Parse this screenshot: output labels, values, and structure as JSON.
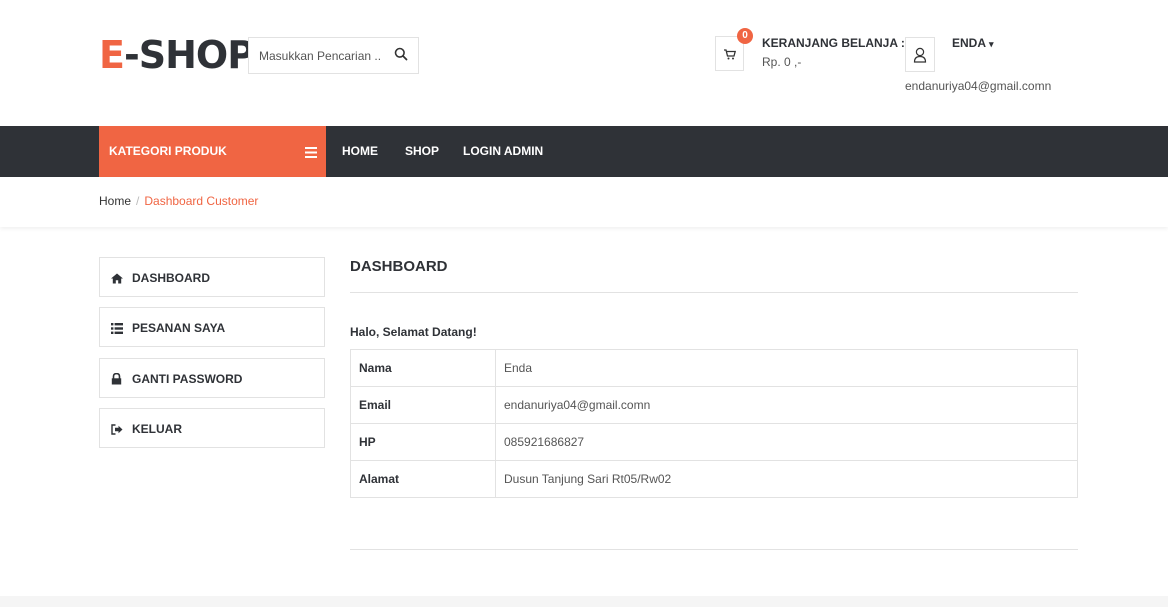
{
  "brand": {
    "logo_first": "E",
    "logo_rest": "-SHOP"
  },
  "search": {
    "placeholder": "Masukkan Pencarian ..",
    "icon": "search-icon"
  },
  "cart": {
    "count": "0",
    "title": "KERANJANG BELANJA :",
    "total": "Rp. 0 ,-",
    "icon": "cart-icon"
  },
  "user": {
    "name": "ENDA",
    "caret": "▾",
    "email": "endanuriya04@gmail.comn",
    "icon": "user-icon"
  },
  "nav": {
    "category_label": "KATEGORI PRODUK",
    "category_icon": "list-icon",
    "links": [
      "HOME",
      "SHOP",
      "LOGIN ADMIN"
    ]
  },
  "breadcrumb": {
    "home": "Home",
    "separator": "/",
    "current": "Dashboard Customer"
  },
  "sidebar": {
    "items": [
      {
        "label": "DASHBOARD",
        "icon": "home-icon"
      },
      {
        "label": "PESANAN SAYA",
        "icon": "list-icon"
      },
      {
        "label": "GANTI PASSWORD",
        "icon": "lock-icon"
      },
      {
        "label": "KELUAR",
        "icon": "sign-out-icon"
      }
    ]
  },
  "main": {
    "title": "DASHBOARD",
    "greeting": "Halo, Selamat Datang!",
    "rows": [
      {
        "key": "Nama",
        "value": "Enda"
      },
      {
        "key": "Email",
        "value": "endanuriya04@gmail.comn"
      },
      {
        "key": "HP",
        "value": "085921686827"
      },
      {
        "key": "Alamat",
        "value": "Dusun Tanjung Sari Rt05/Rw02"
      }
    ]
  },
  "colors": {
    "accent": "#f06543",
    "dark": "#2f3237",
    "border": "#e2e2e2"
  }
}
